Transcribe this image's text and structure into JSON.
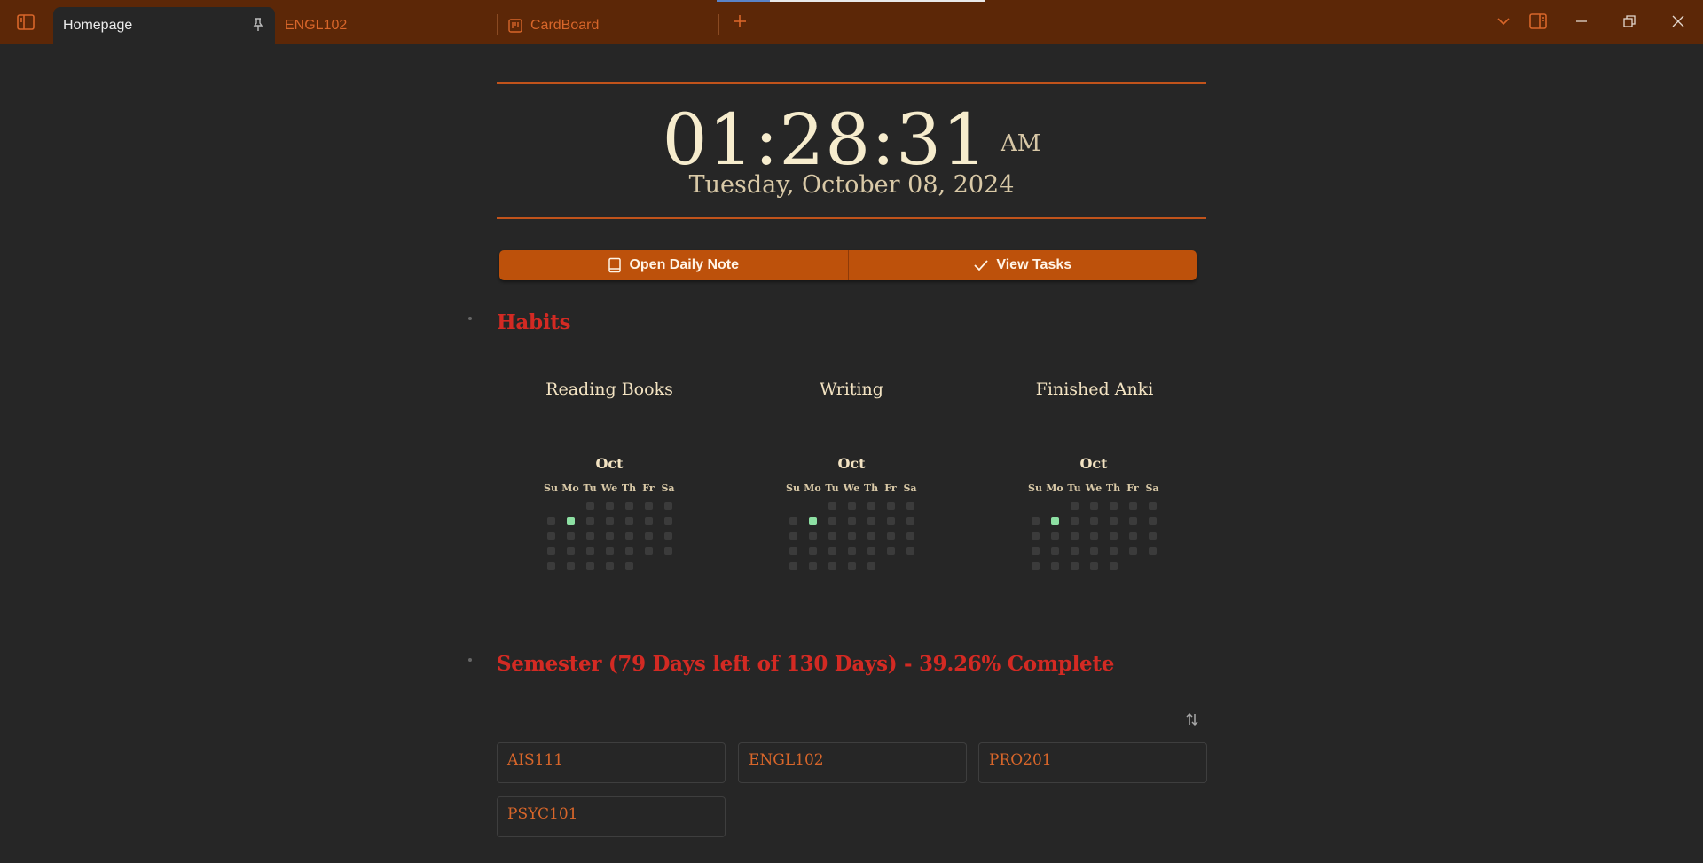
{
  "tabs": [
    {
      "label": "Homepage",
      "active": true,
      "pinned": true
    },
    {
      "label": "ENGL102"
    },
    {
      "label": "CardBoard",
      "icon": "board-icon"
    }
  ],
  "clock": {
    "time": "01:28:31",
    "ampm": "AM",
    "date": "Tuesday, October 08, 2024"
  },
  "actions": {
    "daily_note": "Open Daily Note",
    "view_tasks": "View Tasks"
  },
  "habits": {
    "heading": "Habits",
    "weekdays": [
      "Su",
      "Mo",
      "Tu",
      "We",
      "Th",
      "Fr",
      "Sa"
    ],
    "items": [
      {
        "name": "Reading Books",
        "month": "Oct",
        "done_days": [
          7
        ]
      },
      {
        "name": "Writing",
        "month": "Oct",
        "done_days": [
          7
        ]
      },
      {
        "name": "Finished Anki",
        "month": "Oct",
        "done_days": [
          7
        ]
      }
    ]
  },
  "semester": {
    "heading": "Semester (79 Days left of 130 Days) - 39.26% Complete",
    "courses": [
      "AIS111",
      "ENGL102",
      "PRO201",
      "PSYC101"
    ]
  },
  "colors": {
    "titlebar": "#5c2707",
    "background": "#262626",
    "accent": "#bd510b",
    "heading": "#d32a23",
    "link": "#d8662a",
    "habit_done": "#8de0a3"
  }
}
